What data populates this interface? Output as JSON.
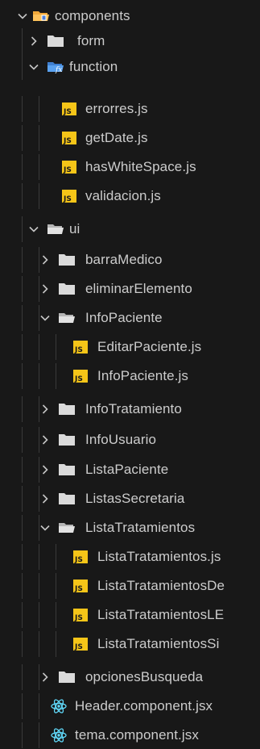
{
  "explorer": {
    "root": {
      "label": "components",
      "icon": "components-folder-open-icon",
      "expanded": true
    },
    "items": [
      {
        "label": "form",
        "icon": "folder-closed-icon",
        "expanded": false
      },
      {
        "label": "function",
        "icon": "function-folder-open-icon",
        "expanded": true
      },
      {
        "label": "errorres.js",
        "icon": "js-file-icon"
      },
      {
        "label": "getDate.js",
        "icon": "js-file-icon"
      },
      {
        "label": "hasWhiteSpace.js",
        "icon": "js-file-icon"
      },
      {
        "label": "validacion.js",
        "icon": "js-file-icon"
      },
      {
        "label": "ui",
        "icon": "folder-open-icon",
        "expanded": true
      },
      {
        "label": "barraMedico",
        "icon": "folder-closed-icon",
        "expanded": false
      },
      {
        "label": "eliminarElemento",
        "icon": "folder-closed-icon",
        "expanded": false
      },
      {
        "label": "InfoPaciente",
        "icon": "folder-open-icon",
        "expanded": true
      },
      {
        "label": "EditarPaciente.js",
        "icon": "js-file-icon"
      },
      {
        "label": "InfoPaciente.js",
        "icon": "js-file-icon"
      },
      {
        "label": "InfoTratamiento",
        "icon": "folder-closed-icon",
        "expanded": false
      },
      {
        "label": "InfoUsuario",
        "icon": "folder-closed-icon",
        "expanded": false
      },
      {
        "label": "ListaPaciente",
        "icon": "folder-closed-icon",
        "expanded": false
      },
      {
        "label": "ListasSecretaria",
        "icon": "folder-closed-icon",
        "expanded": false
      },
      {
        "label": "ListaTratamientos",
        "icon": "folder-open-icon",
        "expanded": true
      },
      {
        "label": "ListaTratamientos.js",
        "icon": "js-file-icon"
      },
      {
        "label": "ListaTratamientosDe",
        "icon": "js-file-icon"
      },
      {
        "label": "ListaTratamientosLE",
        "icon": "js-file-icon"
      },
      {
        "label": "ListaTratamientosSi",
        "icon": "js-file-icon"
      },
      {
        "label": "opcionesBusqueda",
        "icon": "folder-closed-icon",
        "expanded": false
      },
      {
        "label": "Header.component.jsx",
        "icon": "react-file-icon"
      },
      {
        "label": "tema.component.jsx",
        "icon": "react-file-icon"
      }
    ]
  },
  "colors": {
    "background": "#181818",
    "text": "#cccccc",
    "chevron": "#c5c5c5",
    "folder": "#dadada",
    "js_badge_bg": "#f5c518",
    "js_badge_text": "#1a1a1a",
    "react": "#61dafb",
    "components_folder": "#ffb74d",
    "function_folder": "#64b5f6"
  }
}
